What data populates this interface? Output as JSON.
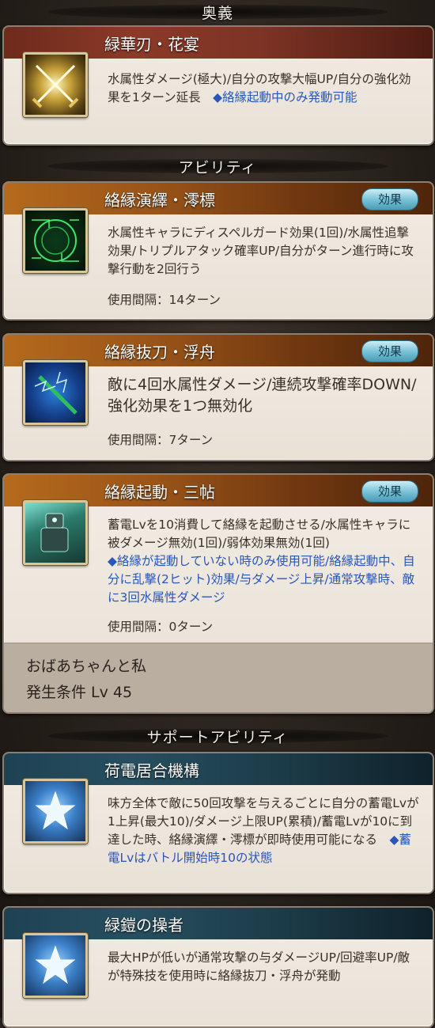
{
  "sections": {
    "ougi": "奥義",
    "ability": "アビリティ",
    "support": "サポートアビリティ"
  },
  "ougi": {
    "title": "緑華刃・花宴",
    "desc_main": "水属性ダメージ(極大)/自分の攻撃大幅UP/自分の強化効果を1ターン延長　",
    "desc_note": "◆絡縁起動中のみ発動可能"
  },
  "abilities": [
    {
      "title": "絡縁演繹・澪標",
      "badge": "効果",
      "desc": "水属性キャラにディスペルガード効果(1回)/水属性追撃効果/トリプルアタック確率UP/自分がターン進行時に攻撃行動を2回行う",
      "interval": "使用間隔：14ターン"
    },
    {
      "title": "絡縁抜刀・浮舟",
      "badge": "効果",
      "desc": "敵に4回水属性ダメージ/連続攻撃確率DOWN/強化効果を1つ無効化",
      "interval": "使用間隔：7ターン"
    },
    {
      "title": "絡縁起動・三帖",
      "badge": "効果",
      "desc": "蓄電Lvを10消費して絡縁を起動させる/水属性キャラに被ダメージ無効(1回)/弱体効果無効(1回)",
      "desc_note": "◆絡縁が起動していない時のみ使用可能/絡縁起動中、自分に乱撃(2ヒット)効果/与ダメージ上昇/通常攻撃時、敵に3回水属性ダメージ",
      "interval": "使用間隔：0ターン",
      "footer_name": "おばあちゃんと私",
      "footer_cond": "発生条件 Lv 45"
    }
  ],
  "supports": [
    {
      "title": "荷電居合機構",
      "desc_main": "味方全体で敵に50回攻撃を与えるごとに自分の蓄電Lvが1上昇(最大10)/ダメージ上限UP(累積)/蓄電Lvが10に到達した時、絡縁演繹・澪標が即時使用可能になる　",
      "desc_note": "◆蓄電Lvはバトル開始時10の状態"
    },
    {
      "title": "緑鎧の操者",
      "desc_main": "最大HPが低いが通常攻撃の与ダメージUP/回避率UP/敵が特殊技を使用時に絡縁抜刀・浮舟が発動"
    }
  ],
  "icons": [
    "crossed-swords-icon",
    "green-circuit-icon",
    "lightning-sword-icon",
    "mech-armor-icon",
    "star-icon",
    "star-icon"
  ]
}
